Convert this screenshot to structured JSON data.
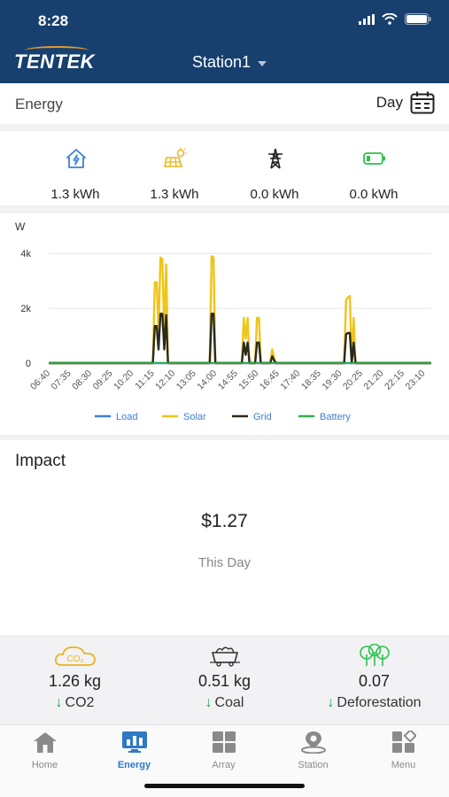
{
  "status_bar": {
    "time": "8:28"
  },
  "header": {
    "logo": "TENTEK",
    "station": "Station1"
  },
  "energy_section": {
    "title": "Energy",
    "period": "Day"
  },
  "summary": [
    {
      "icon": "house-energy-icon",
      "value": "1.3 kWh",
      "color": "#3b82d6"
    },
    {
      "icon": "solar-panel-icon",
      "value": "1.3 kWh",
      "color": "#e8b41e"
    },
    {
      "icon": "grid-tower-icon",
      "value": "0.0 kWh",
      "color": "#222222"
    },
    {
      "icon": "battery-icon",
      "value": "0.0 kWh",
      "color": "#2cc24a"
    }
  ],
  "chart_data": {
    "type": "line",
    "ylabel": "W",
    "y_ticks": [
      "4k",
      "2k",
      "0"
    ],
    "ylim": [
      0,
      4200
    ],
    "grid": true,
    "legend_placement": "bottom",
    "x_tick_labels": [
      "06:40",
      "07:35",
      "08:30",
      "09:25",
      "10:20",
      "11:15",
      "12:10",
      "13:05",
      "14:00",
      "14:55",
      "15:50",
      "16:45",
      "17:40",
      "18:35",
      "19:30",
      "20:25",
      "21:20",
      "22:15",
      "23:10"
    ],
    "x_start": "06:40",
    "x_end": "23:30",
    "series": [
      {
        "name": "Load",
        "color": "#3b82d6",
        "points": [
          [
            "06:40",
            0
          ],
          [
            "23:30",
            0
          ]
        ]
      },
      {
        "name": "Solar",
        "color": "#f0c419",
        "points": [
          [
            "06:40",
            0
          ],
          [
            "11:15",
            0
          ],
          [
            "11:20",
            2950
          ],
          [
            "11:25",
            2950
          ],
          [
            "11:30",
            1200
          ],
          [
            "11:35",
            3850
          ],
          [
            "11:40",
            3800
          ],
          [
            "11:45",
            1100
          ],
          [
            "11:50",
            3600
          ],
          [
            "11:55",
            0
          ],
          [
            "13:45",
            0
          ],
          [
            "13:50",
            3900
          ],
          [
            "13:55",
            3850
          ],
          [
            "14:00",
            0
          ],
          [
            "15:10",
            0
          ],
          [
            "15:15",
            1650
          ],
          [
            "15:20",
            900
          ],
          [
            "15:25",
            1650
          ],
          [
            "15:30",
            0
          ],
          [
            "15:45",
            0
          ],
          [
            "15:50",
            1650
          ],
          [
            "15:55",
            1650
          ],
          [
            "16:00",
            0
          ],
          [
            "16:25",
            0
          ],
          [
            "16:30",
            500
          ],
          [
            "16:35",
            200
          ],
          [
            "16:40",
            0
          ],
          [
            "19:40",
            0
          ],
          [
            "19:45",
            2300
          ],
          [
            "19:50",
            2400
          ],
          [
            "19:55",
            2450
          ],
          [
            "20:00",
            0
          ],
          [
            "20:05",
            1650
          ],
          [
            "20:10",
            0
          ],
          [
            "23:30",
            0
          ]
        ]
      },
      {
        "name": "Grid",
        "color": "#2a2a1a",
        "points": [
          [
            "06:40",
            0
          ],
          [
            "11:15",
            0
          ],
          [
            "11:20",
            1350
          ],
          [
            "11:25",
            1350
          ],
          [
            "11:30",
            500
          ],
          [
            "11:35",
            1800
          ],
          [
            "11:40",
            1800
          ],
          [
            "11:45",
            500
          ],
          [
            "11:50",
            1750
          ],
          [
            "11:55",
            0
          ],
          [
            "13:45",
            0
          ],
          [
            "13:50",
            1800
          ],
          [
            "13:55",
            1800
          ],
          [
            "14:00",
            0
          ],
          [
            "15:10",
            0
          ],
          [
            "15:15",
            750
          ],
          [
            "15:20",
            300
          ],
          [
            "15:25",
            750
          ],
          [
            "15:30",
            0
          ],
          [
            "15:45",
            0
          ],
          [
            "15:50",
            750
          ],
          [
            "15:55",
            750
          ],
          [
            "16:00",
            0
          ],
          [
            "16:25",
            0
          ],
          [
            "16:30",
            250
          ],
          [
            "16:35",
            100
          ],
          [
            "16:40",
            0
          ],
          [
            "19:40",
            0
          ],
          [
            "19:45",
            1050
          ],
          [
            "19:50",
            1100
          ],
          [
            "19:55",
            1100
          ],
          [
            "20:00",
            0
          ],
          [
            "20:05",
            750
          ],
          [
            "20:10",
            0
          ],
          [
            "23:30",
            0
          ]
        ]
      },
      {
        "name": "Battery",
        "color": "#2db34a",
        "points": [
          [
            "06:40",
            0
          ],
          [
            "23:30",
            0
          ]
        ]
      }
    ]
  },
  "impact": {
    "title": "Impact",
    "amount": "$1.27",
    "period": "This Day"
  },
  "environment": [
    {
      "icon": "co2-cloud-icon",
      "value": "1.26 kg",
      "label": "CO2",
      "color": "#e8b41e"
    },
    {
      "icon": "coal-cart-icon",
      "value": "0.51 kg",
      "label": "Coal",
      "color": "#333333"
    },
    {
      "icon": "trees-icon",
      "value": "0.07",
      "label": "Deforestation",
      "color": "#2cc24a"
    }
  ],
  "env_arrow": "↓",
  "tabs": [
    {
      "label": "Home",
      "icon": "home-icon",
      "active": false
    },
    {
      "label": "Energy",
      "icon": "energy-chart-icon",
      "active": true
    },
    {
      "label": "Array",
      "icon": "array-grid-icon",
      "active": false
    },
    {
      "label": "Station",
      "icon": "station-pin-icon",
      "active": false
    },
    {
      "label": "Menu",
      "icon": "menu-squares-icon",
      "active": false
    }
  ],
  "colors": {
    "header_bg": "#17406f",
    "active_tab": "#2f79c4",
    "inactive_tab": "#8a8a8a"
  }
}
